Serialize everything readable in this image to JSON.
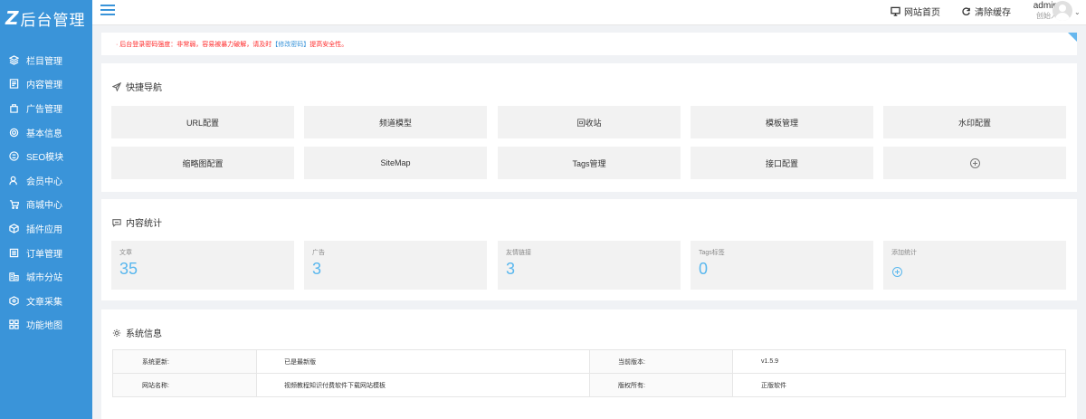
{
  "brand": {
    "mark": "Z",
    "title": "后台管理"
  },
  "sidebar": {
    "items": [
      {
        "label": "栏目管理",
        "icon": "layers-icon"
      },
      {
        "label": "内容管理",
        "icon": "document-icon"
      },
      {
        "label": "广告管理",
        "icon": "ad-icon"
      },
      {
        "label": "基本信息",
        "icon": "gear-icon"
      },
      {
        "label": "SEO模块",
        "icon": "seo-icon"
      },
      {
        "label": "会员中心",
        "icon": "user-icon"
      },
      {
        "label": "商城中心",
        "icon": "cart-icon"
      },
      {
        "label": "插件应用",
        "icon": "plugin-icon"
      },
      {
        "label": "订单管理",
        "icon": "order-icon"
      },
      {
        "label": "城市分站",
        "icon": "city-icon"
      },
      {
        "label": "文章采集",
        "icon": "collect-icon"
      },
      {
        "label": "功能地图",
        "icon": "grid-icon"
      }
    ]
  },
  "header": {
    "site_home": "网站首页",
    "clear_cache": "清除缓存",
    "user_name": "admin",
    "user_role": "创始人"
  },
  "notice": {
    "bullet": "·",
    "text_before": "后台登录密码强度：非常弱，容易被暴力破解，请及时",
    "link": "【修改密码】",
    "text_after": "提高安全性。"
  },
  "quick_nav": {
    "title": "快捷导航",
    "buttons": [
      "URL配置",
      "频道模型",
      "回收站",
      "模板管理",
      "水印配置",
      "缩略图配置",
      "SiteMap",
      "Tags管理",
      "接口配置"
    ],
    "add_icon": "plus-circle-icon"
  },
  "content_stats": {
    "title": "内容统计",
    "items": [
      {
        "label": "文章",
        "value": "35"
      },
      {
        "label": "广告",
        "value": "3"
      },
      {
        "label": "友情链接",
        "value": "3"
      },
      {
        "label": "Tags标签",
        "value": "0"
      }
    ],
    "add_label": "添加统计"
  },
  "system_info": {
    "title": "系统信息",
    "rows": [
      {
        "k1": "系统更新:",
        "v1": "已是最新版",
        "k2": "当前版本:",
        "v2": "v1.5.9"
      },
      {
        "k1": "网站名称:",
        "v1": "视频教程知识付费软件下载网站模板",
        "k2": "版权所有:",
        "v2": "正版软件"
      }
    ]
  },
  "colors": {
    "sidebar": "#3a94d9",
    "accent": "#59b7ee",
    "warning": "#ff2a2a"
  }
}
